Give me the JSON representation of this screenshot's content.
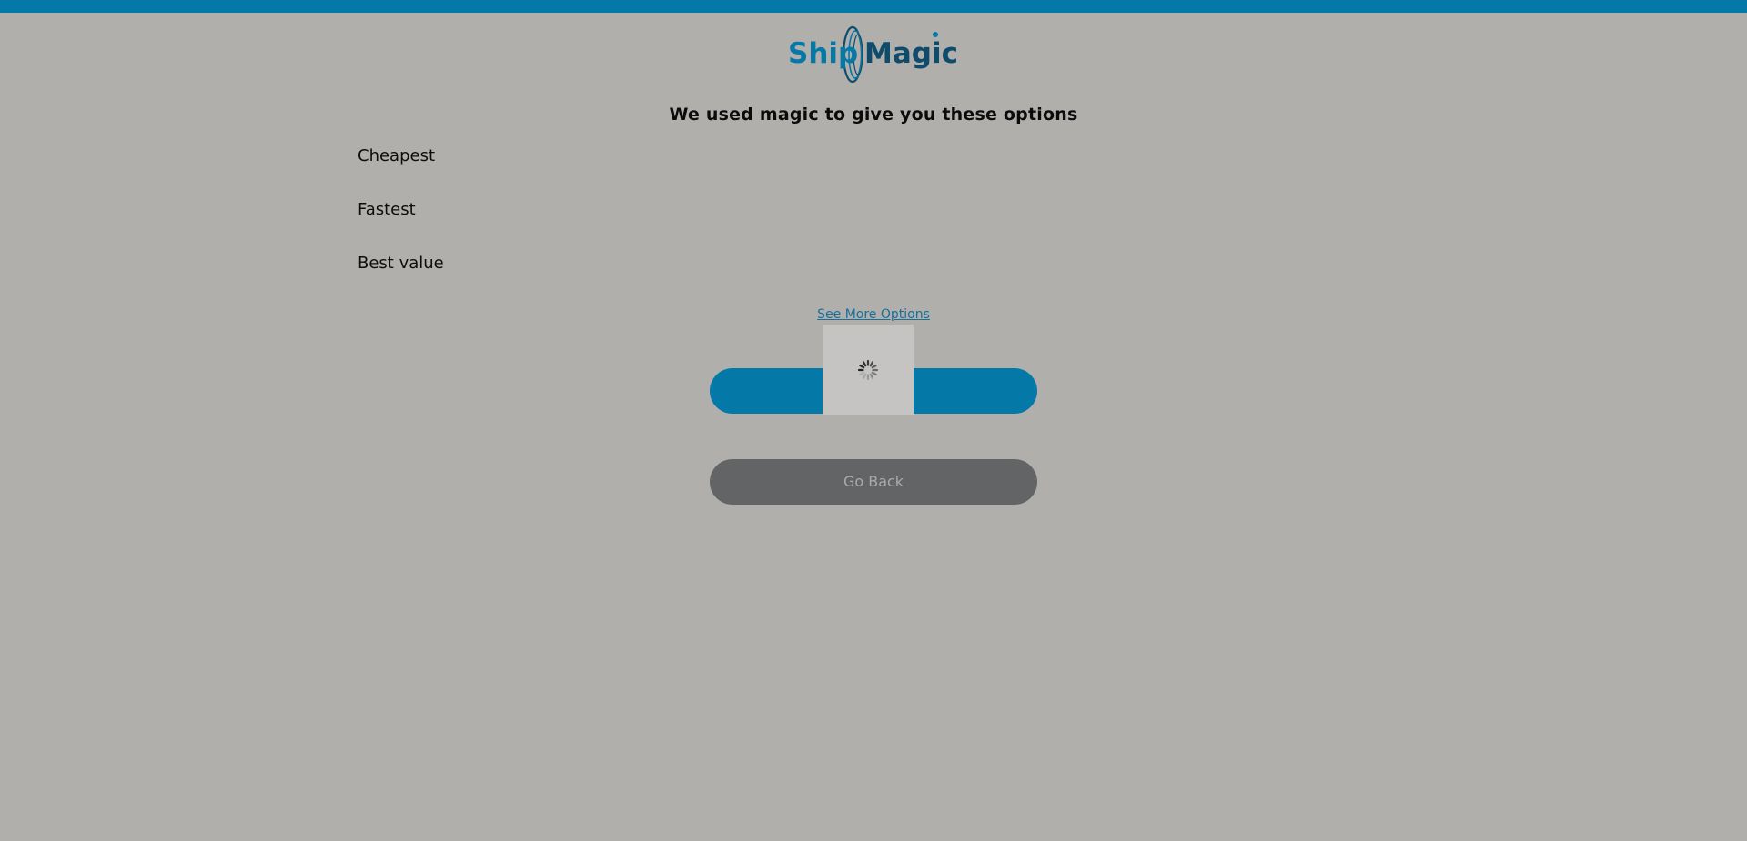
{
  "header": {
    "bar_color": "#0479a8"
  },
  "logo": {
    "text_left": "Ship",
    "text_right": "Magic",
    "color_left": "#0479a8",
    "color_right": "#0f4c6b"
  },
  "main": {
    "heading": "We used magic to give you these options",
    "options": [
      {
        "label": "Cheapest"
      },
      {
        "label": "Fastest"
      },
      {
        "label": "Best value"
      }
    ],
    "see_more_link": "See More Options",
    "primary_button_label": "",
    "back_button_label": "Go Back"
  },
  "overlay": {
    "state": "loading",
    "spinner_icon": "loading-spinner-icon"
  },
  "colors": {
    "background": "#b0afac",
    "primary": "#0479a8",
    "back_button": "#636465"
  }
}
